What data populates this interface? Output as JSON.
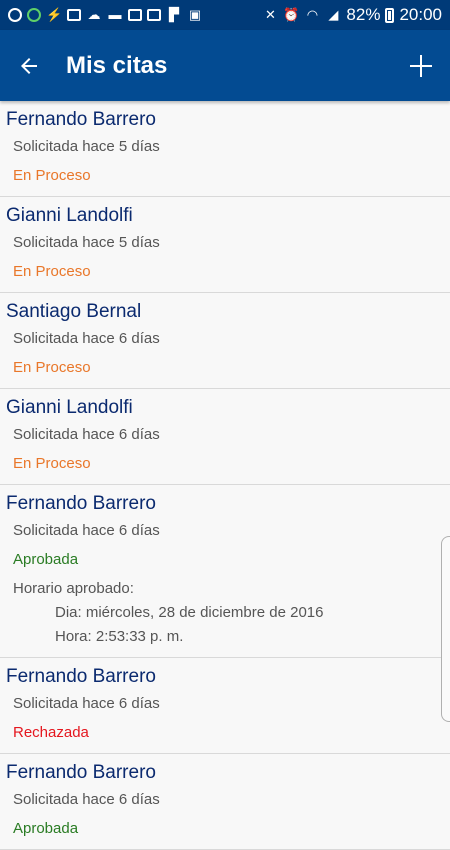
{
  "status_bar": {
    "battery": "82%",
    "time": "20:00"
  },
  "header": {
    "title": "Mis citas"
  },
  "appointments": [
    {
      "name": "Fernando Barrero",
      "requested": "Solicitada hace 5 días",
      "status": "En Proceso"
    },
    {
      "name": "Gianni Landolfi",
      "requested": "Solicitada hace 5 días",
      "status": "En Proceso"
    },
    {
      "name": "Santiago Bernal",
      "requested": "Solicitada hace 6 días",
      "status": "En Proceso"
    },
    {
      "name": "Gianni Landolfi",
      "requested": "Solicitada hace 6 días",
      "status": "En Proceso"
    },
    {
      "name": "Fernando Barrero",
      "requested": "Solicitada hace 6 días",
      "status": "Aprobada",
      "schedule_label": "Horario aprobado:",
      "schedule_day": "Dia: miércoles, 28 de diciembre de 2016",
      "schedule_time": "Hora: 2:53:33 p. m."
    },
    {
      "name": "Fernando Barrero",
      "requested": "Solicitada hace 6 días",
      "status": "Rechazada"
    },
    {
      "name": "Fernando Barrero",
      "requested": "Solicitada hace 6 días",
      "status": "Aprobada"
    }
  ]
}
